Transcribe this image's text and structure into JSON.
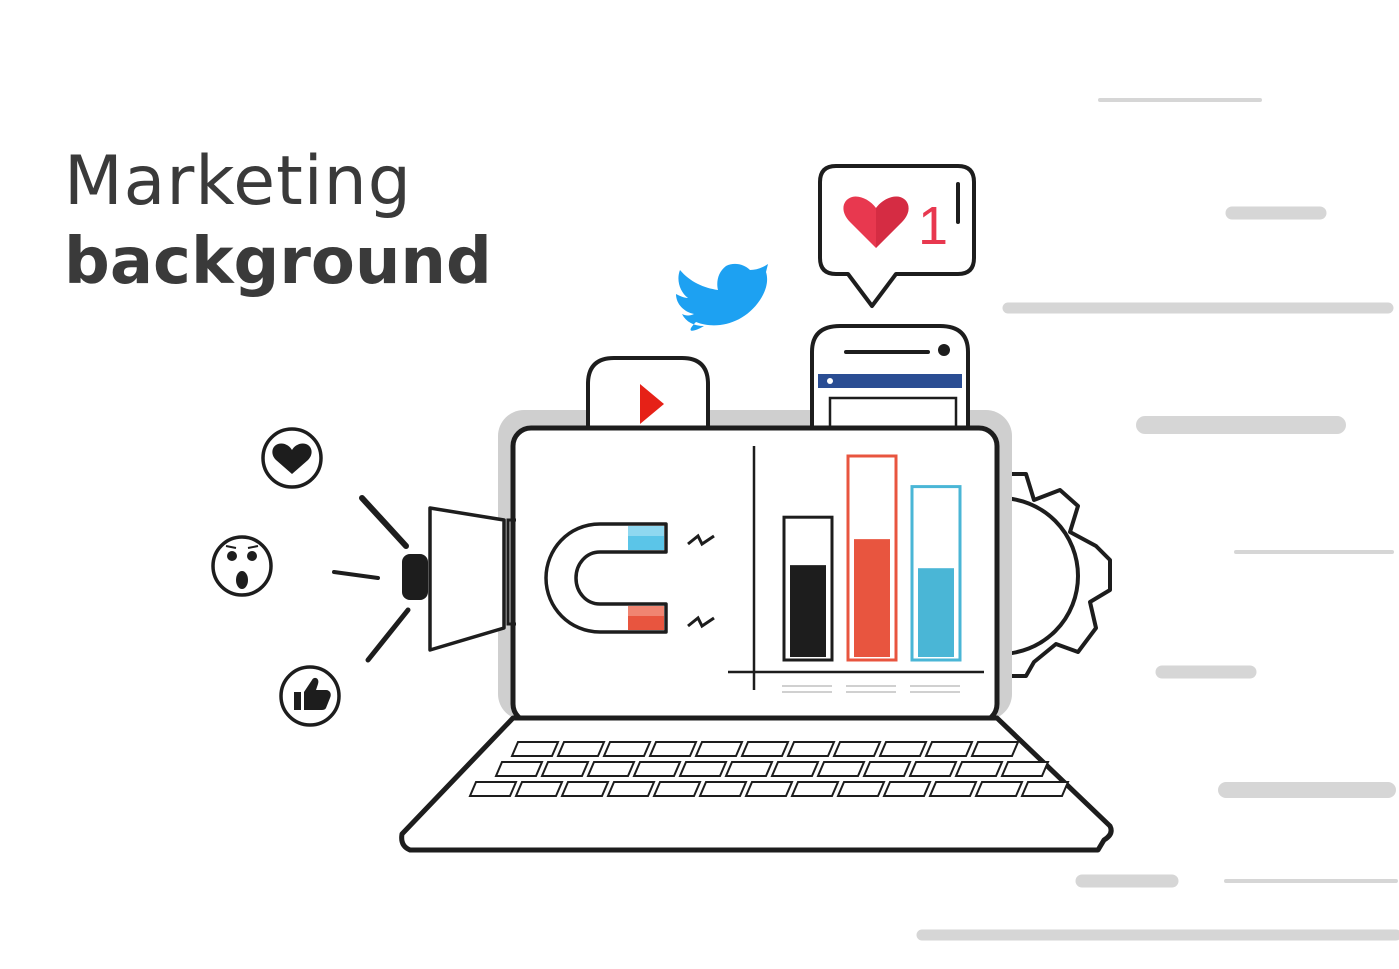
{
  "title": {
    "line1": "Marketing",
    "line2": "background"
  },
  "notification": {
    "count": "1",
    "icon": "heart-icon"
  },
  "icons": {
    "twitter": "twitter-bird-icon",
    "youtube": "play-icon",
    "reactions": [
      "heart-icon",
      "surprised-face-icon",
      "thumbs-up-icon"
    ],
    "magnet": "magnet-icon",
    "megaphone": "megaphone-icon",
    "gear": "gear-icon",
    "laptop": "laptop-icon",
    "phone": "smartphone-icon"
  },
  "chart_data": {
    "type": "bar",
    "series": [
      {
        "values": [
          0.62
        ],
        "color": "#1d1d1d"
      },
      {
        "values": [
          0.79
        ],
        "color": "#e8553f"
      },
      {
        "values": [
          0.6
        ],
        "color": "#4ab6d6"
      }
    ]
  },
  "colors": {
    "text": "#3a3a3a",
    "heart": "#e8384f",
    "twitter": "#1da1f2",
    "youtube": "#e62117",
    "magnet_blue": "#5bc5e8",
    "magnet_red": "#e8553f",
    "facebook_bar": "#2a4d93",
    "speed_lines": "#d6d6d6"
  }
}
